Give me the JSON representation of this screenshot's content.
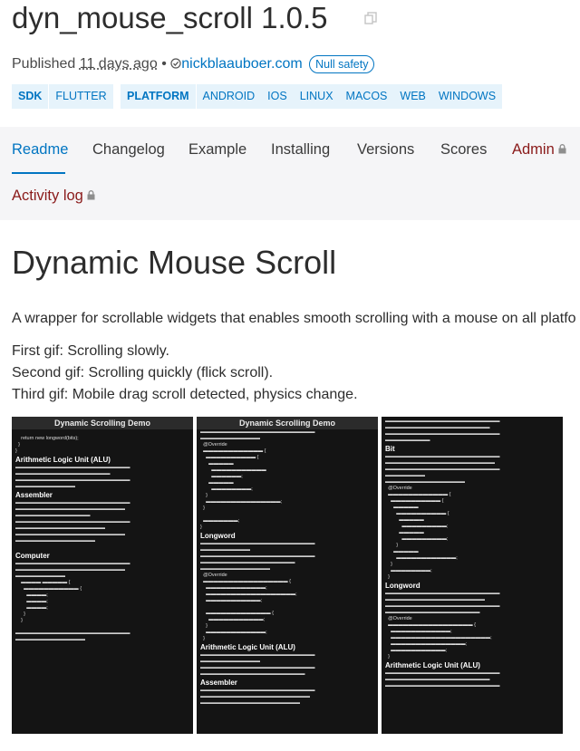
{
  "package": {
    "name": "dyn_mouse_scroll 1.0.5",
    "published_label": "Published",
    "published_ago": "11 days ago",
    "bullet": "•",
    "publisher": "nickblaauboer.com",
    "badge": "Null safety"
  },
  "tags": {
    "sdk_label": "SDK",
    "sdk": [
      "FLUTTER"
    ],
    "platform_label": "PLATFORM",
    "platforms": [
      "ANDROID",
      "IOS",
      "LINUX",
      "MACOS",
      "WEB",
      "WINDOWS"
    ]
  },
  "tabs": [
    "Readme",
    "Changelog",
    "Example",
    "Installing",
    "Versions",
    "Scores",
    "Admin",
    "Activity log"
  ],
  "readme": {
    "heading": "Dynamic Mouse Scroll",
    "intro": "A wrapper for scrollable widgets that enables smooth scrolling with a mouse on all platfo",
    "gif1": "First gif: Scrolling slowly.",
    "gif2": "Second gif: Scrolling quickly (flick scroll).",
    "gif3": "Third gif: Mobile drag scroll detected, physics change."
  },
  "gifs": {
    "g1_header": "Dynamic Scrolling Demo",
    "g2_header": "Dynamic Scrolling Demo",
    "g1_h_alu": "Arithmetic Logic Unit (ALU)",
    "g1_h_asm": "Assembler",
    "g1_h_cmp": "Computer",
    "g2_h_long": "Longword",
    "g2_h_alu": "Arithmetic Logic Unit (ALU)",
    "g2_h_asm": "Assembler",
    "g3_h_bit": "Bit",
    "g3_h_long": "Longword",
    "g3_h_alu": "Arithmetic Logic Unit (ALU)"
  },
  "colors": {
    "accent": "#0175c2",
    "tag_bg": "#e6f3fb",
    "tab_bg": "#f5f5f7",
    "admin": "#8a1a1a"
  }
}
